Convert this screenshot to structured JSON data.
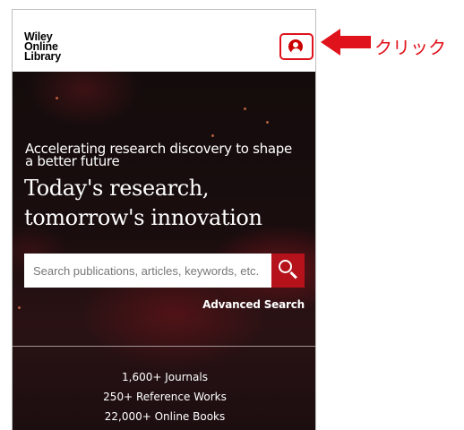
{
  "header": {
    "logo_line1": "Wiley",
    "logo_line2": "Online",
    "logo_line3": "Library",
    "account_icon": "user-circle-icon"
  },
  "hero": {
    "subtitle": "Accelerating research discovery to shape a better future",
    "headline": "Today's research, tomorrow's innovation"
  },
  "search": {
    "placeholder": "Search publications, articles, keywords, etc.",
    "button_icon": "search-icon",
    "advanced_label": "Advanced Search"
  },
  "stats": [
    "1,600+ Journals",
    "250+ Reference Works",
    "22,000+ Online Books"
  ],
  "annotation": {
    "label": "クリック",
    "color": "#e0121b"
  },
  "colors": {
    "accent": "#b5121b",
    "highlight": "#e0121b"
  }
}
